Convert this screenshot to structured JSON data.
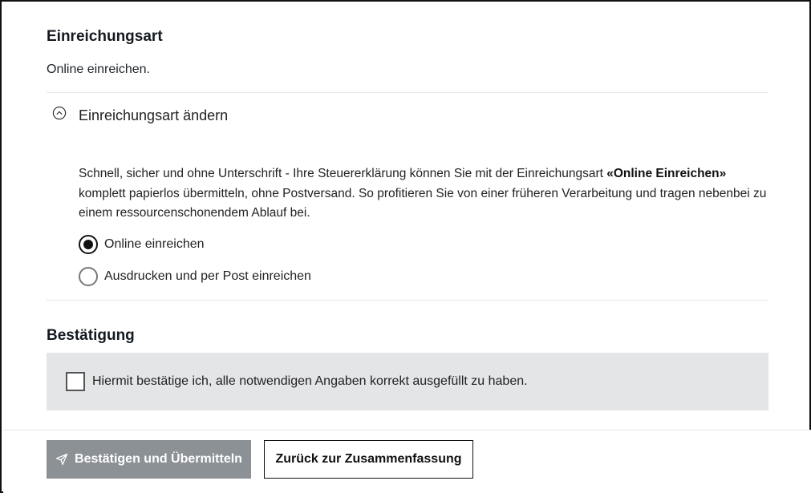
{
  "submission": {
    "title": "Einreichungsart",
    "current_value": "Online einreichen.",
    "toggle_label": "Einreichungsart ändern",
    "toggle_icon": "chevron-up-circle-icon",
    "description_before": "Schnell, sicher und ohne Unterschrift - Ihre Steuererklärung können Sie mit der Einreichungsart ",
    "description_bold": "«Online Einreichen»",
    "description_after": " komplett papierlos übermitteln, ohne Postversand. So profitieren Sie von einer früheren Verarbeitung und tragen nebenbei zu einem ressourcenschonendem Ablauf bei.",
    "options": [
      {
        "label": "Online einreichen",
        "selected": true
      },
      {
        "label": "Ausdrucken und per Post einreichen",
        "selected": false
      }
    ]
  },
  "confirmation": {
    "title": "Bestätigung",
    "checkbox_label": "Hiermit bestätige ich, alle notwendigen Angaben korrekt ausgefüllt zu haben.",
    "checked": false
  },
  "footer": {
    "submit_label": "Bestätigen und Übermitteln",
    "submit_icon": "send-icon",
    "back_label": "Zurück zur Zusammenfassung"
  },
  "colors": {
    "primary_disabled": "#8c9196",
    "confirm_bg": "#e4e5e7",
    "divider": "#e3e5e8"
  }
}
